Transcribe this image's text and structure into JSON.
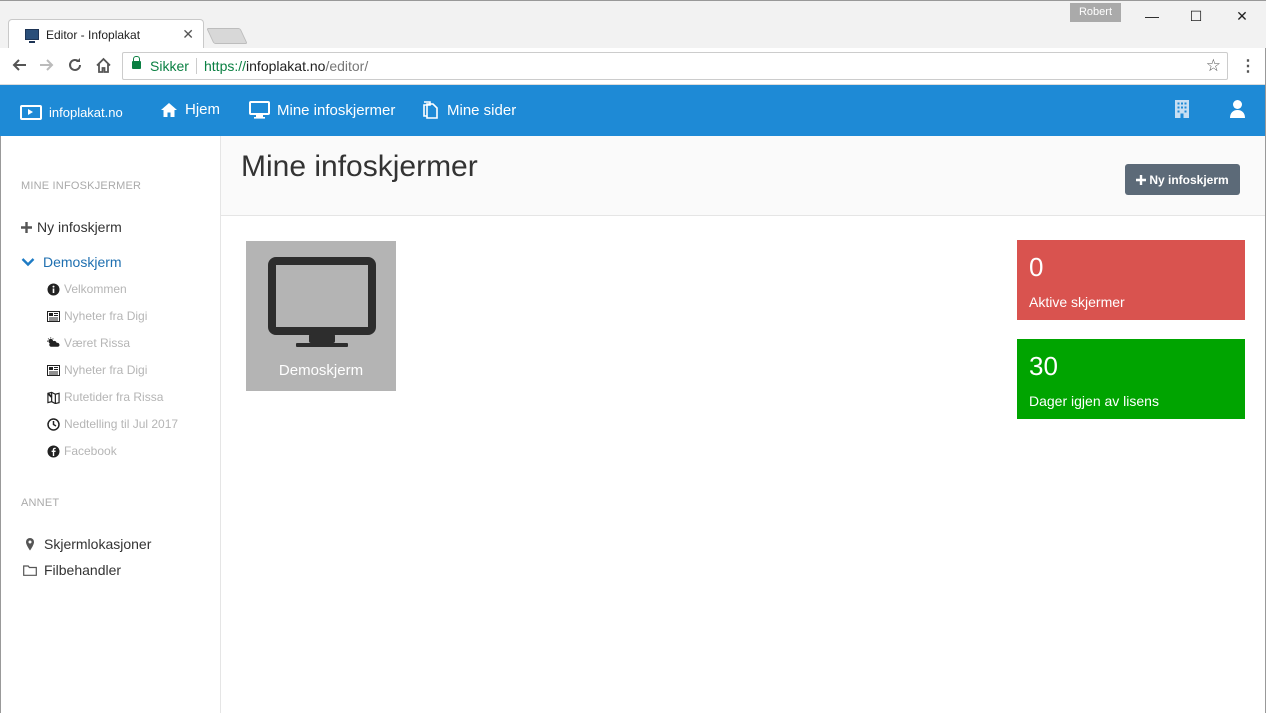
{
  "browser": {
    "tab_title": "Editor - Infoplakat",
    "tab_close": "✕",
    "profile_name": "Robert",
    "window_minimize": "—",
    "window_maximize": "☐",
    "window_close": "✕",
    "security_label": "Sikker",
    "url_protocol": "https://",
    "url_host": "infoplakat.no",
    "url_path": "/editor/"
  },
  "navbar": {
    "brand": "infoplakat.no",
    "links": [
      {
        "label": "Hjem",
        "icon": "home-icon"
      },
      {
        "label": "Mine infoskjermer",
        "icon": "monitor-icon"
      },
      {
        "label": "Mine sider",
        "icon": "pages-icon"
      }
    ],
    "color": "#1e8ad6"
  },
  "sidebar": {
    "heading": "MINE INFOSKJERMER",
    "new_screen": "Ny infoskjerm",
    "screen_group": "Demoskjerm",
    "pages": [
      {
        "label": "Velkommen",
        "icon": "info-icon"
      },
      {
        "label": "Nyheter fra Digi",
        "icon": "news-icon"
      },
      {
        "label": "Været Rissa",
        "icon": "weather-icon"
      },
      {
        "label": "Nyheter fra Digi",
        "icon": "news-icon"
      },
      {
        "label": "Rutetider fra Rissa",
        "icon": "map-icon"
      },
      {
        "label": "Nedtelling til Jul 2017",
        "icon": "clock-icon"
      },
      {
        "label": "Facebook",
        "icon": "facebook-icon"
      }
    ],
    "other_heading": "ANNET",
    "other_items": [
      {
        "label": "Skjermlokasjoner",
        "icon": "map-marker-icon"
      },
      {
        "label": "Filbehandler",
        "icon": "folder-icon"
      }
    ]
  },
  "main": {
    "title": "Mine infoskjermer",
    "new_button": "Ny infoskjerm",
    "screens": [
      {
        "label": "Demoskjerm"
      }
    ],
    "stats": [
      {
        "value": "0",
        "label": "Aktive skjermer",
        "color": "#d9534f"
      },
      {
        "value": "30",
        "label": "Dager igjen av lisens",
        "color": "#00a400"
      }
    ]
  }
}
